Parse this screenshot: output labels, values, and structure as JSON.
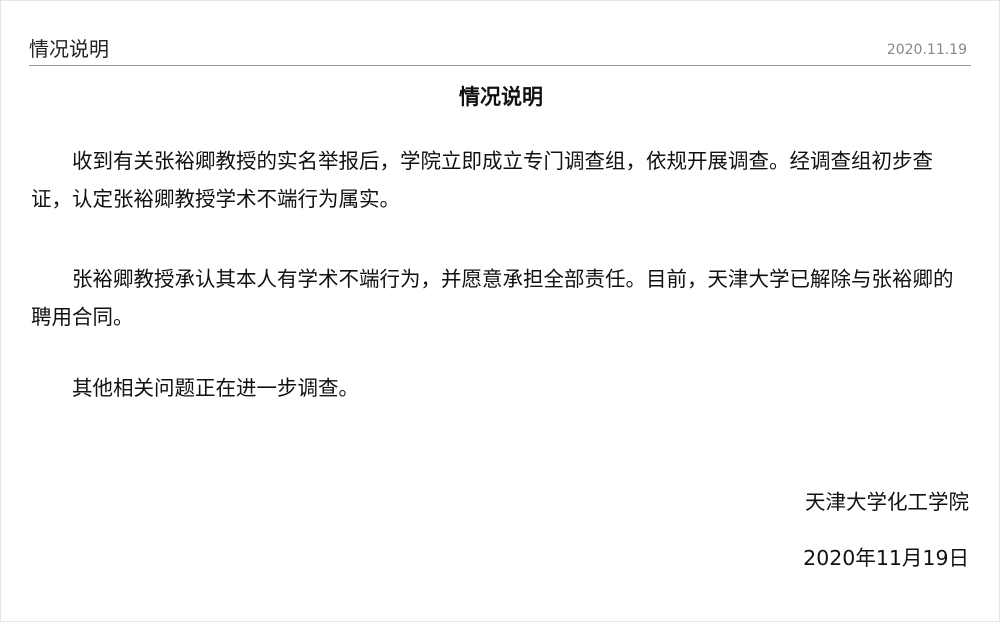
{
  "header": {
    "title": "情况说明",
    "date": "2020.11.19"
  },
  "document": {
    "title": "情况说明",
    "paragraphs": [
      "收到有关张裕卿教授的实名举报后，学院立即成立专门调查组，依规开展调查。经调查组初步查证，认定张裕卿教授学术不端行为属实。",
      "张裕卿教授承认其本人有学术不端行为，并愿意承担全部责任。目前，天津大学已解除与张裕卿的聘用合同。",
      "其他相关问题正在进一步调查。"
    ],
    "signature": {
      "organization": "天津大学化工学院",
      "date": "2020年11月19日"
    }
  }
}
